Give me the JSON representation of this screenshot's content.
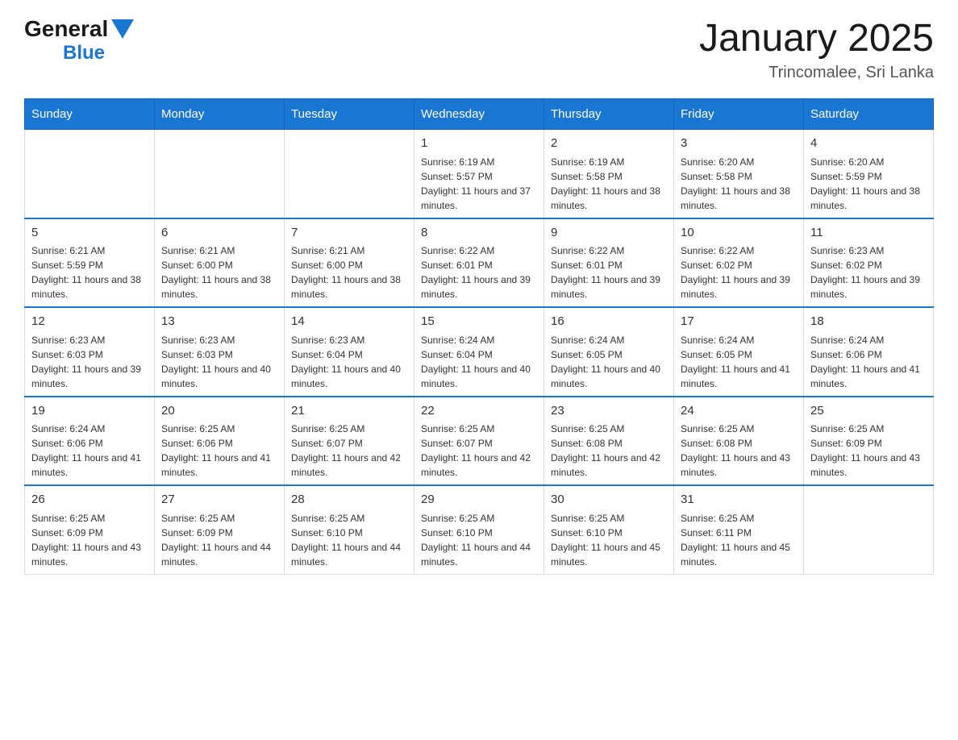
{
  "header": {
    "logo_general": "General",
    "logo_blue": "Blue",
    "month_title": "January 2025",
    "location": "Trincomalee, Sri Lanka"
  },
  "days_of_week": [
    "Sunday",
    "Monday",
    "Tuesday",
    "Wednesday",
    "Thursday",
    "Friday",
    "Saturday"
  ],
  "weeks": [
    [
      {
        "day": "",
        "info": ""
      },
      {
        "day": "",
        "info": ""
      },
      {
        "day": "",
        "info": ""
      },
      {
        "day": "1",
        "info": "Sunrise: 6:19 AM\nSunset: 5:57 PM\nDaylight: 11 hours and 37 minutes."
      },
      {
        "day": "2",
        "info": "Sunrise: 6:19 AM\nSunset: 5:58 PM\nDaylight: 11 hours and 38 minutes."
      },
      {
        "day": "3",
        "info": "Sunrise: 6:20 AM\nSunset: 5:58 PM\nDaylight: 11 hours and 38 minutes."
      },
      {
        "day": "4",
        "info": "Sunrise: 6:20 AM\nSunset: 5:59 PM\nDaylight: 11 hours and 38 minutes."
      }
    ],
    [
      {
        "day": "5",
        "info": "Sunrise: 6:21 AM\nSunset: 5:59 PM\nDaylight: 11 hours and 38 minutes."
      },
      {
        "day": "6",
        "info": "Sunrise: 6:21 AM\nSunset: 6:00 PM\nDaylight: 11 hours and 38 minutes."
      },
      {
        "day": "7",
        "info": "Sunrise: 6:21 AM\nSunset: 6:00 PM\nDaylight: 11 hours and 38 minutes."
      },
      {
        "day": "8",
        "info": "Sunrise: 6:22 AM\nSunset: 6:01 PM\nDaylight: 11 hours and 39 minutes."
      },
      {
        "day": "9",
        "info": "Sunrise: 6:22 AM\nSunset: 6:01 PM\nDaylight: 11 hours and 39 minutes."
      },
      {
        "day": "10",
        "info": "Sunrise: 6:22 AM\nSunset: 6:02 PM\nDaylight: 11 hours and 39 minutes."
      },
      {
        "day": "11",
        "info": "Sunrise: 6:23 AM\nSunset: 6:02 PM\nDaylight: 11 hours and 39 minutes."
      }
    ],
    [
      {
        "day": "12",
        "info": "Sunrise: 6:23 AM\nSunset: 6:03 PM\nDaylight: 11 hours and 39 minutes."
      },
      {
        "day": "13",
        "info": "Sunrise: 6:23 AM\nSunset: 6:03 PM\nDaylight: 11 hours and 40 minutes."
      },
      {
        "day": "14",
        "info": "Sunrise: 6:23 AM\nSunset: 6:04 PM\nDaylight: 11 hours and 40 minutes."
      },
      {
        "day": "15",
        "info": "Sunrise: 6:24 AM\nSunset: 6:04 PM\nDaylight: 11 hours and 40 minutes."
      },
      {
        "day": "16",
        "info": "Sunrise: 6:24 AM\nSunset: 6:05 PM\nDaylight: 11 hours and 40 minutes."
      },
      {
        "day": "17",
        "info": "Sunrise: 6:24 AM\nSunset: 6:05 PM\nDaylight: 11 hours and 41 minutes."
      },
      {
        "day": "18",
        "info": "Sunrise: 6:24 AM\nSunset: 6:06 PM\nDaylight: 11 hours and 41 minutes."
      }
    ],
    [
      {
        "day": "19",
        "info": "Sunrise: 6:24 AM\nSunset: 6:06 PM\nDaylight: 11 hours and 41 minutes."
      },
      {
        "day": "20",
        "info": "Sunrise: 6:25 AM\nSunset: 6:06 PM\nDaylight: 11 hours and 41 minutes."
      },
      {
        "day": "21",
        "info": "Sunrise: 6:25 AM\nSunset: 6:07 PM\nDaylight: 11 hours and 42 minutes."
      },
      {
        "day": "22",
        "info": "Sunrise: 6:25 AM\nSunset: 6:07 PM\nDaylight: 11 hours and 42 minutes."
      },
      {
        "day": "23",
        "info": "Sunrise: 6:25 AM\nSunset: 6:08 PM\nDaylight: 11 hours and 42 minutes."
      },
      {
        "day": "24",
        "info": "Sunrise: 6:25 AM\nSunset: 6:08 PM\nDaylight: 11 hours and 43 minutes."
      },
      {
        "day": "25",
        "info": "Sunrise: 6:25 AM\nSunset: 6:09 PM\nDaylight: 11 hours and 43 minutes."
      }
    ],
    [
      {
        "day": "26",
        "info": "Sunrise: 6:25 AM\nSunset: 6:09 PM\nDaylight: 11 hours and 43 minutes."
      },
      {
        "day": "27",
        "info": "Sunrise: 6:25 AM\nSunset: 6:09 PM\nDaylight: 11 hours and 44 minutes."
      },
      {
        "day": "28",
        "info": "Sunrise: 6:25 AM\nSunset: 6:10 PM\nDaylight: 11 hours and 44 minutes."
      },
      {
        "day": "29",
        "info": "Sunrise: 6:25 AM\nSunset: 6:10 PM\nDaylight: 11 hours and 44 minutes."
      },
      {
        "day": "30",
        "info": "Sunrise: 6:25 AM\nSunset: 6:10 PM\nDaylight: 11 hours and 45 minutes."
      },
      {
        "day": "31",
        "info": "Sunrise: 6:25 AM\nSunset: 6:11 PM\nDaylight: 11 hours and 45 minutes."
      },
      {
        "day": "",
        "info": ""
      }
    ]
  ]
}
